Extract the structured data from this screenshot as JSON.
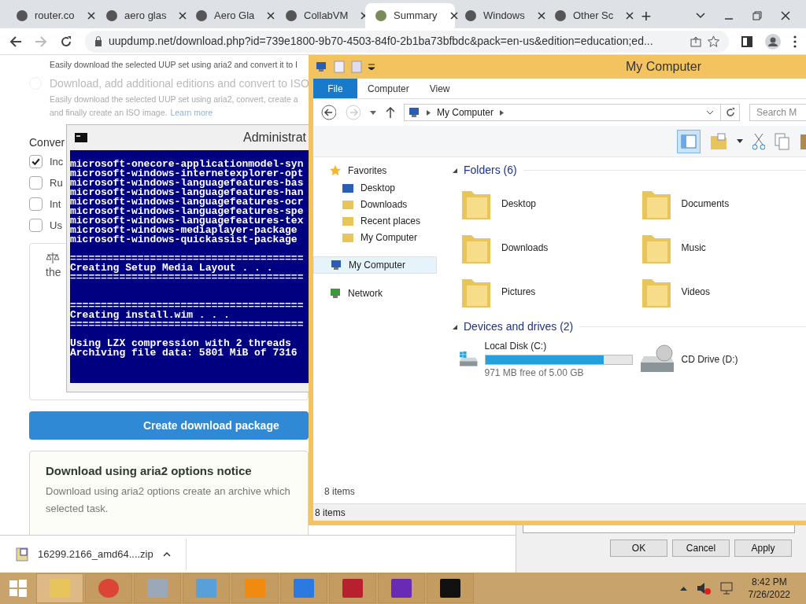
{
  "browser": {
    "tabs": [
      {
        "label": "router.co",
        "selected": false
      },
      {
        "label": "aero glas",
        "selected": false
      },
      {
        "label": "Aero Gla",
        "selected": false
      },
      {
        "label": "CollabVM",
        "selected": false
      },
      {
        "label": "Summary",
        "selected": true
      },
      {
        "label": "Windows",
        "selected": false
      },
      {
        "label": "Other Sc",
        "selected": false
      }
    ],
    "new_tab": "+",
    "url": "uupdump.net/download.php?id=739e1800-9b70-4503-84f0-2b1ba73bfbdc&pack=en-us&edition=education;ed..."
  },
  "page": {
    "option_desc_1": "Easily download the selected UUP set using aria2 and convert it to I",
    "option_title_2": "Download, add additional editions and convert to ISO",
    "option_2_selected": false,
    "option_desc_2a": "Easily download the selected UUP set using aria2, convert, create a",
    "option_desc_2b": "and finally create an ISO image.",
    "learn_more": "Learn more",
    "conversion_heading": "Conver",
    "checkboxes": [
      {
        "label": "Inc",
        "checked": true
      },
      {
        "label": "Ru",
        "checked": false
      },
      {
        "label": "Int",
        "checked": false
      },
      {
        "label": "Us",
        "checked": false
      }
    ],
    "license_text": "the",
    "create_button": "Create download package",
    "notice_title": "Download using aria2 options notice",
    "notice_text_1": "Download using aria2 options create an archive which",
    "notice_text_2": "selected task."
  },
  "download_bar": {
    "file": "16299.2166_amd64....zip"
  },
  "cmd": {
    "title": "Administrat",
    "lines": [
      {
        "kind": "text",
        "text": "microsoft-onecore-applicationmodel-syn"
      },
      {
        "kind": "text",
        "text": "microsoft-windows-internetexplorer-opt"
      },
      {
        "kind": "text",
        "text": "microsoft-windows-languagefeatures-bas"
      },
      {
        "kind": "text",
        "text": "microsoft-windows-languagefeatures-han"
      },
      {
        "kind": "text",
        "text": "microsoft-windows-languagefeatures-ocr"
      },
      {
        "kind": "text",
        "text": "microsoft-windows-languagefeatures-spe"
      },
      {
        "kind": "text",
        "text": "microsoft-windows-languagefeatures-tex"
      },
      {
        "kind": "text",
        "text": "microsoft-windows-mediaplayer-package"
      },
      {
        "kind": "text",
        "text": "microsoft-windows-quickassist-package"
      },
      {
        "kind": "blank"
      },
      {
        "kind": "text",
        "text": "======================================"
      },
      {
        "kind": "text",
        "text": "Creating Setup Media Layout . . ."
      },
      {
        "kind": "text",
        "text": "======================================"
      },
      {
        "kind": "blank"
      },
      {
        "kind": "blank"
      },
      {
        "kind": "text",
        "text": "======================================"
      },
      {
        "kind": "text",
        "text": "Creating install.wim . . ."
      },
      {
        "kind": "text",
        "text": "======================================"
      },
      {
        "kind": "blank"
      },
      {
        "kind": "text",
        "text": "Using LZX compression with 2 threads"
      },
      {
        "kind": "text",
        "text": "Archiving file data: 5801 MiB of 7316"
      }
    ]
  },
  "explorer": {
    "title": "My Computer",
    "ribbon_tabs": [
      {
        "label": "File",
        "selected": true
      },
      {
        "label": "Computer",
        "selected": false
      },
      {
        "label": "View",
        "selected": false
      }
    ],
    "path": "My Computer",
    "search_placeholder": "Search M",
    "nav": [
      {
        "label": "Favorites",
        "selected": false,
        "children": [
          {
            "label": "Desktop",
            "selected": false
          },
          {
            "label": "Downloads",
            "selected": false
          },
          {
            "label": "Recent places",
            "selected": false
          },
          {
            "label": "My Computer",
            "selected": false
          }
        ]
      },
      {
        "label": "My Computer",
        "selected": true
      },
      {
        "label": "Network",
        "selected": false
      }
    ],
    "folders_heading": "Folders (6)",
    "folders": [
      "Desktop",
      "Documents",
      "Downloads",
      "Music",
      "Pictures",
      "Videos"
    ],
    "drives_heading": "Devices and drives (2)",
    "drives": [
      {
        "kind": "disk",
        "name": "Local Disk (C:)",
        "level": 0.81,
        "free": "971 MB free of 5.00 GB"
      },
      {
        "kind": "optical",
        "name": "CD Drive (D:)"
      }
    ],
    "item_count": "8 items",
    "status": "8 items"
  },
  "dialog": {
    "buttons": [
      "OK",
      "Cancel",
      "Apply"
    ]
  },
  "taskbar": {
    "time": "8:42 PM",
    "date": "7/26/2022"
  }
}
